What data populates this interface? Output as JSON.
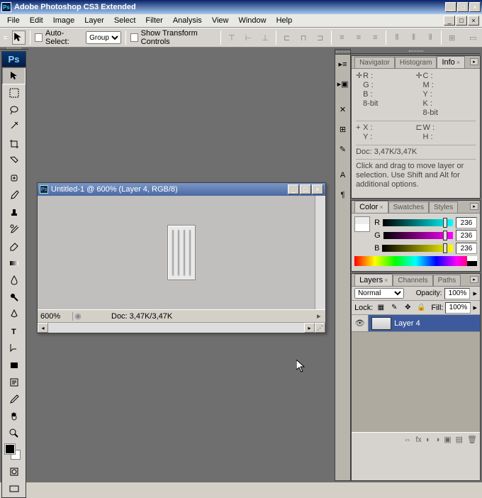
{
  "app": {
    "title": "Adobe Photoshop CS3 Extended",
    "logo": "Ps"
  },
  "menu": [
    "File",
    "Edit",
    "Image",
    "Layer",
    "Select",
    "Filter",
    "Analysis",
    "View",
    "Window",
    "Help"
  ],
  "options": {
    "autoSelectLabel": "Auto-Select:",
    "groupSelect": "Group",
    "showTransformLabel": "Show Transform Controls"
  },
  "document": {
    "title": "Untitled-1 @ 600% (Layer 4, RGB/8)",
    "zoom": "600%",
    "docSize": "Doc: 3,47K/3,47K"
  },
  "panels": {
    "navigator": {
      "tabs": [
        "Navigator",
        "Histogram",
        "Info"
      ]
    },
    "info": {
      "r": "R :",
      "g": "G :",
      "b": "B :",
      "bit1": "8-bit",
      "c": "C :",
      "m": "M :",
      "y": "Y :",
      "k": "K :",
      "bit2": "8-bit",
      "x": "X :",
      "ylbl": "Y :",
      "w": "W :",
      "h": "H :",
      "doc": "Doc: 3,47K/3,47K",
      "hint": "Click and drag to move layer or selection. Use Shift and Alt for additional options."
    },
    "color": {
      "tabs": [
        "Color",
        "Swatches",
        "Styles"
      ],
      "r": "R",
      "g": "G",
      "b": "B",
      "rval": "236",
      "gval": "236",
      "bval": "236"
    },
    "layers": {
      "tabs": [
        "Layers",
        "Channels",
        "Paths"
      ],
      "blend": "Normal",
      "opacityLabel": "Opacity:",
      "opacity": "100%",
      "lockLabel": "Lock:",
      "fillLabel": "Fill:",
      "fill": "100%",
      "layer4": "Layer 4"
    }
  }
}
